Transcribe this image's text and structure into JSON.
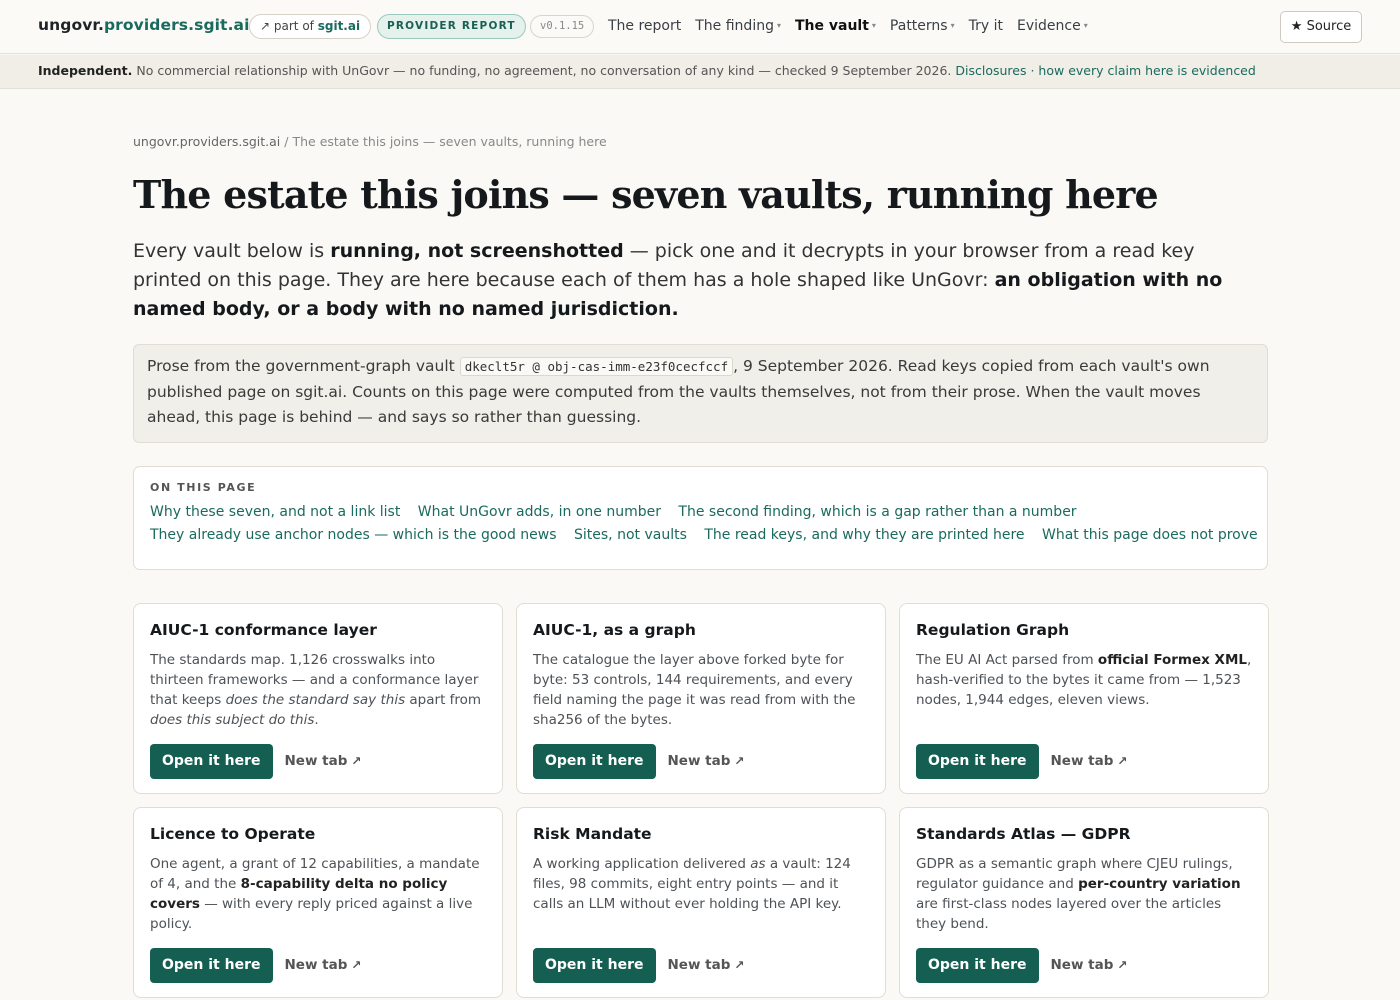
{
  "header": {
    "brand_prefix": "ungovr.",
    "brand_domain": "providers.sgit.ai",
    "partof_arrow": "↗",
    "partof_text": "part of",
    "partof_link": "sgit.ai",
    "report_pill": "PROVIDER REPORT",
    "version": "v0.1.15",
    "nav": [
      {
        "label": "The report",
        "caret": ""
      },
      {
        "label": "The finding",
        "caret": "▾"
      },
      {
        "label": "The vault",
        "caret": "▾"
      },
      {
        "label": "Patterns",
        "caret": "▾"
      },
      {
        "label": "Try it",
        "caret": ""
      },
      {
        "label": "Evidence",
        "caret": "▾"
      }
    ],
    "source_button": "★ Source"
  },
  "banner": {
    "strong": "Independent.",
    "text": "No commercial relationship with UnGovr — no funding, no agreement, no conversation of any kind — checked 9 September 2026.",
    "link_disclosures": "Disclosures",
    "sep": "·",
    "link_evidence": "how every claim here is evidenced"
  },
  "breadcrumb": {
    "root": "ungovr.providers.sgit.ai",
    "sep": "/",
    "current": "The estate this joins — seven vaults, running here"
  },
  "page": {
    "title": "The estate this joins — seven vaults, running here",
    "lead_1": "Every vault below is",
    "lead_b1": "running, not screenshotted",
    "lead_2": "— pick one and it decrypts in your browser from a read key printed on this page. They are here because each of them has a hole shaped like UnGovr:",
    "lead_b2": "an obligation with no named body, or a body with no named jurisdiction.",
    "note_1": "Prose from the government-graph vault",
    "note_code": "dkeclt5r @ obj-cas-imm-e23f0cecfccf",
    "note_2": ", 9 September 2026. Read keys copied from each vault's own published page on sgit.ai. Counts on this page were computed from the vaults themselves, not from their prose. When the vault moves ahead, this page is behind — and says so rather than guessing."
  },
  "toc": {
    "heading": "ON THIS PAGE",
    "row1": [
      "Why these seven, and not a link list",
      "What UnGovr adds, in one number",
      "The second finding, which is a gap rather than a number"
    ],
    "row2": [
      "They already use anchor nodes — which is the good news",
      "Sites, not vaults",
      "The read keys, and why they are printed here",
      "What this page does not prove"
    ]
  },
  "cards": [
    {
      "title": "AIUC-1 conformance layer",
      "desc": [
        {
          "t": "The standards map. 1,126 crosswalks into thirteen frameworks — and a conformance layer that keeps ",
          "s": ""
        },
        {
          "t": "does the standard say this",
          "s": "i"
        },
        {
          "t": " apart from ",
          "s": ""
        },
        {
          "t": "does this subject do this",
          "s": "i"
        },
        {
          "t": ".",
          "s": ""
        }
      ]
    },
    {
      "title": "AIUC-1, as a graph",
      "desc": [
        {
          "t": "The catalogue the layer above forked byte for byte: 53 controls, 144 requirements, and every field naming the page it was read from with the sha256 of the bytes.",
          "s": ""
        }
      ]
    },
    {
      "title": "Regulation Graph",
      "desc": [
        {
          "t": "The EU AI Act parsed from ",
          "s": ""
        },
        {
          "t": "official Formex XML",
          "s": "b"
        },
        {
          "t": ", hash-verified to the bytes it came from — 1,523 nodes, 1,944 edges, eleven views.",
          "s": ""
        }
      ]
    },
    {
      "title": "Licence to Operate",
      "desc": [
        {
          "t": "One agent, a grant of 12 capabilities, a mandate of 4, and the ",
          "s": ""
        },
        {
          "t": "8-capability delta no policy covers",
          "s": "b"
        },
        {
          "t": " — with every reply priced against a live policy.",
          "s": ""
        }
      ]
    },
    {
      "title": "Risk Mandate",
      "desc": [
        {
          "t": "A working application delivered ",
          "s": ""
        },
        {
          "t": "as",
          "s": "i"
        },
        {
          "t": " a vault: 124 files, 98 commits, eight entry points — and it calls an LLM without ever holding the API key.",
          "s": ""
        }
      ]
    },
    {
      "title": "Standards Atlas — GDPR",
      "desc": [
        {
          "t": "GDPR as a semantic graph where CJEU rulings, regulator guidance and ",
          "s": ""
        },
        {
          "t": "per-country variation",
          "s": "b"
        },
        {
          "t": " are first-class nodes layered over the articles they bend.",
          "s": ""
        }
      ]
    }
  ],
  "card_actions": {
    "open": "Open it here",
    "new_tab": "New tab",
    "new_tab_arrow": "↗"
  },
  "colors": {
    "accent": "#1a6a5e",
    "button": "#155e52",
    "background": "#faf9f6"
  }
}
